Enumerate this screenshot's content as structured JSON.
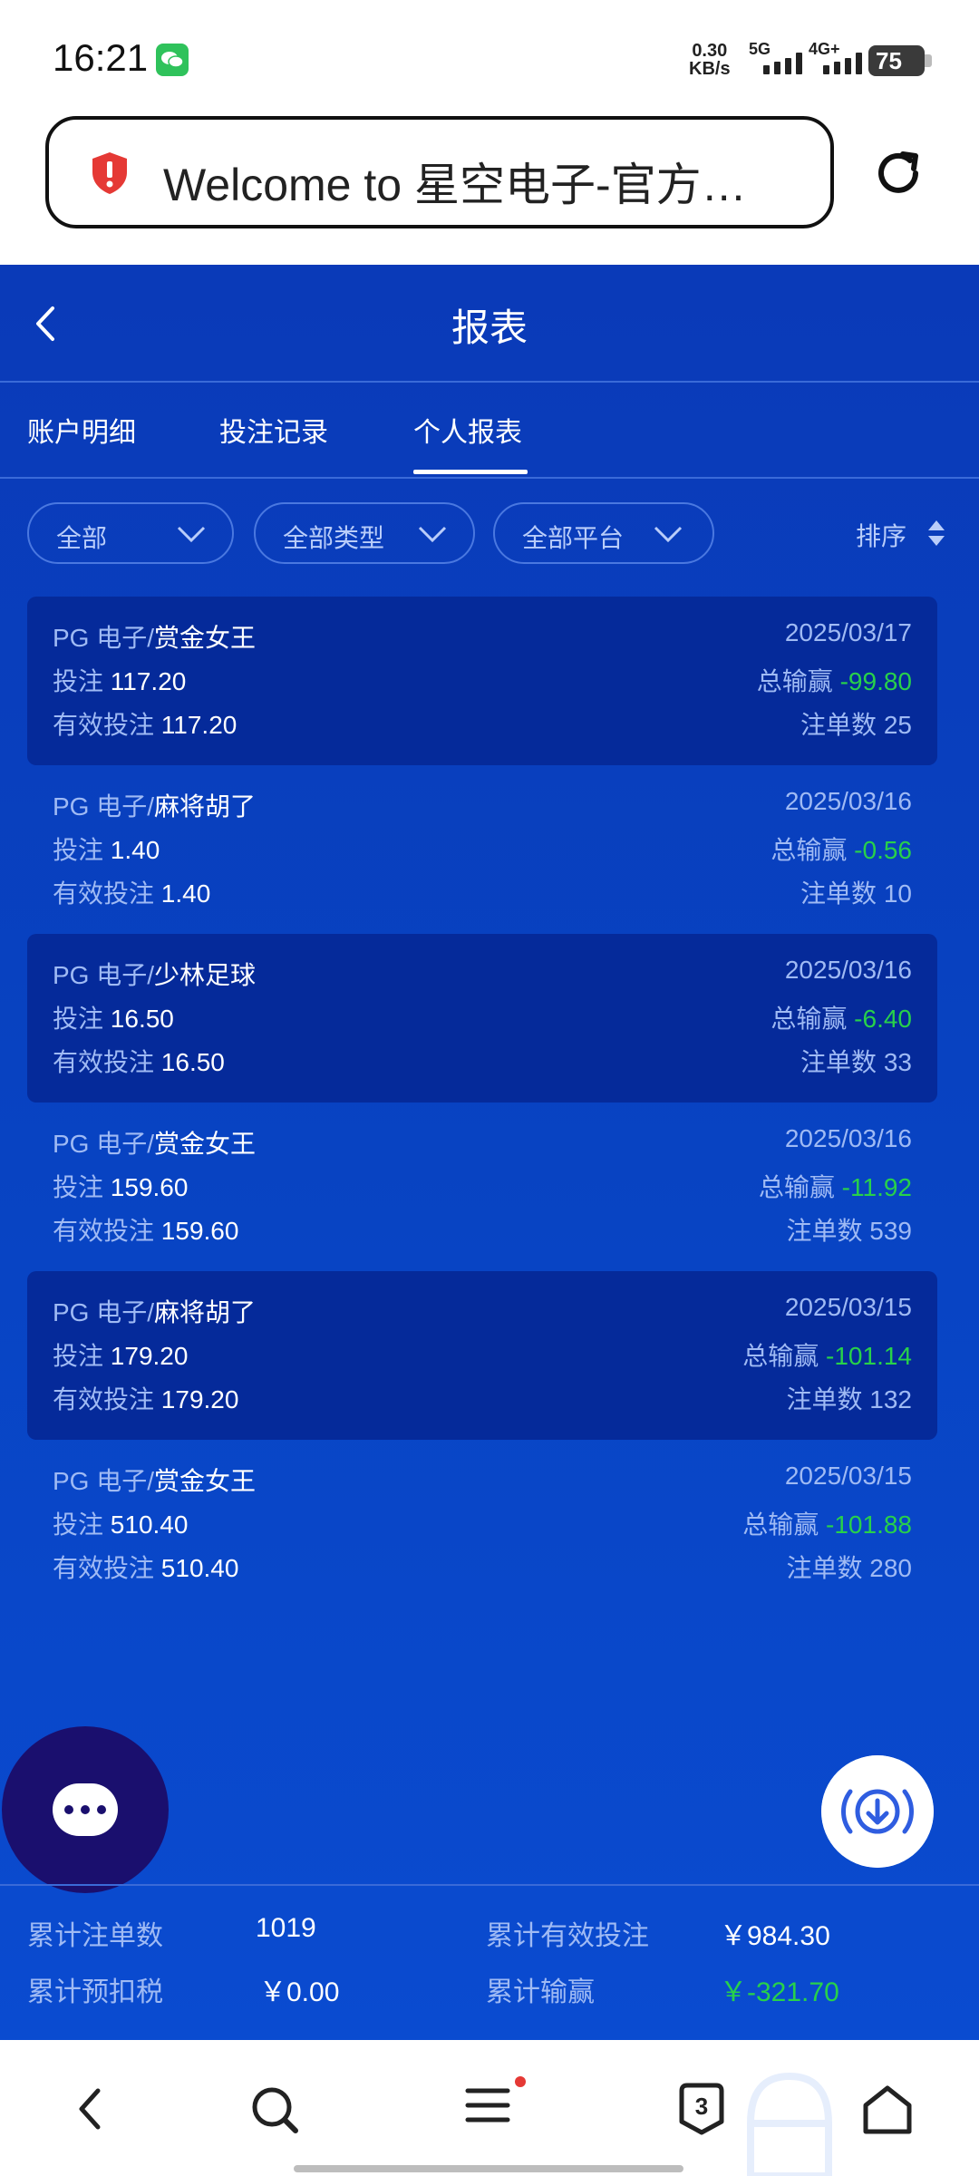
{
  "status_bar": {
    "time": "16:21",
    "net_speed_value": "0.30",
    "net_speed_unit": "KB/s",
    "sim1_label": "5G",
    "sim2_label": "4G+",
    "battery": "75"
  },
  "browser": {
    "url_text": "Welcome to 星空电子-官方…",
    "tab_count": "3"
  },
  "header": {
    "title": "报表"
  },
  "tabs": [
    {
      "label": "账户明细"
    },
    {
      "label": "投注记录"
    },
    {
      "label": "个人报表",
      "active": true
    }
  ],
  "filters": {
    "range": "全部",
    "type": "全部类型",
    "platform": "全部平台",
    "sort": "排序"
  },
  "records": [
    {
      "provider": "PG 电子/",
      "game": "赏金女王",
      "date": "2025/03/17",
      "bet_label": "投注",
      "bet": "117.20",
      "valid_label": "有效投注",
      "valid": "117.20",
      "winloss_label": "总输赢",
      "winloss": "-99.80",
      "orders_label": "注单数",
      "orders": "25"
    },
    {
      "provider": "PG 电子/",
      "game": "麻将胡了",
      "date": "2025/03/16",
      "bet_label": "投注",
      "bet": "1.40",
      "valid_label": "有效投注",
      "valid": "1.40",
      "winloss_label": "总输赢",
      "winloss": "-0.56",
      "orders_label": "注单数",
      "orders": "10"
    },
    {
      "provider": "PG 电子/",
      "game": "少林足球",
      "date": "2025/03/16",
      "bet_label": "投注",
      "bet": "16.50",
      "valid_label": "有效投注",
      "valid": "16.50",
      "winloss_label": "总输赢",
      "winloss": "-6.40",
      "orders_label": "注单数",
      "orders": "33"
    },
    {
      "provider": "PG 电子/",
      "game": "赏金女王",
      "date": "2025/03/16",
      "bet_label": "投注",
      "bet": "159.60",
      "valid_label": "有效投注",
      "valid": "159.60",
      "winloss_label": "总输赢",
      "winloss": "-11.92",
      "orders_label": "注单数",
      "orders": "539"
    },
    {
      "provider": "PG 电子/",
      "game": "麻将胡了",
      "date": "2025/03/15",
      "bet_label": "投注",
      "bet": "179.20",
      "valid_label": "有效投注",
      "valid": "179.20",
      "winloss_label": "总输赢",
      "winloss": "-101.14",
      "orders_label": "注单数",
      "orders": "132"
    },
    {
      "provider": "PG 电子/",
      "game": "赏金女王",
      "date": "2025/03/15",
      "bet_label": "投注",
      "bet": "510.40",
      "valid_label": "有效投注",
      "valid": "510.40",
      "winloss_label": "总输赢",
      "winloss": "-101.88",
      "orders_label": "注单数",
      "orders": "280"
    }
  ],
  "summary": {
    "total_orders_label": "累计注单数",
    "total_orders": "1019",
    "total_valid_label": "累计有效投注",
    "total_valid": "￥984.30",
    "prewithheld_tax_label": "累计预扣税",
    "prewithheld_tax": "￥0.00",
    "total_winloss_label": "累计输赢",
    "total_winloss": "￥-321.70"
  },
  "colors": {
    "app_background": "#0843c2",
    "card_dark": "#052a9a",
    "label_blue": "#9fbaf4",
    "loss_green": "#28d14a",
    "chat_button": "#1a0f6e"
  }
}
